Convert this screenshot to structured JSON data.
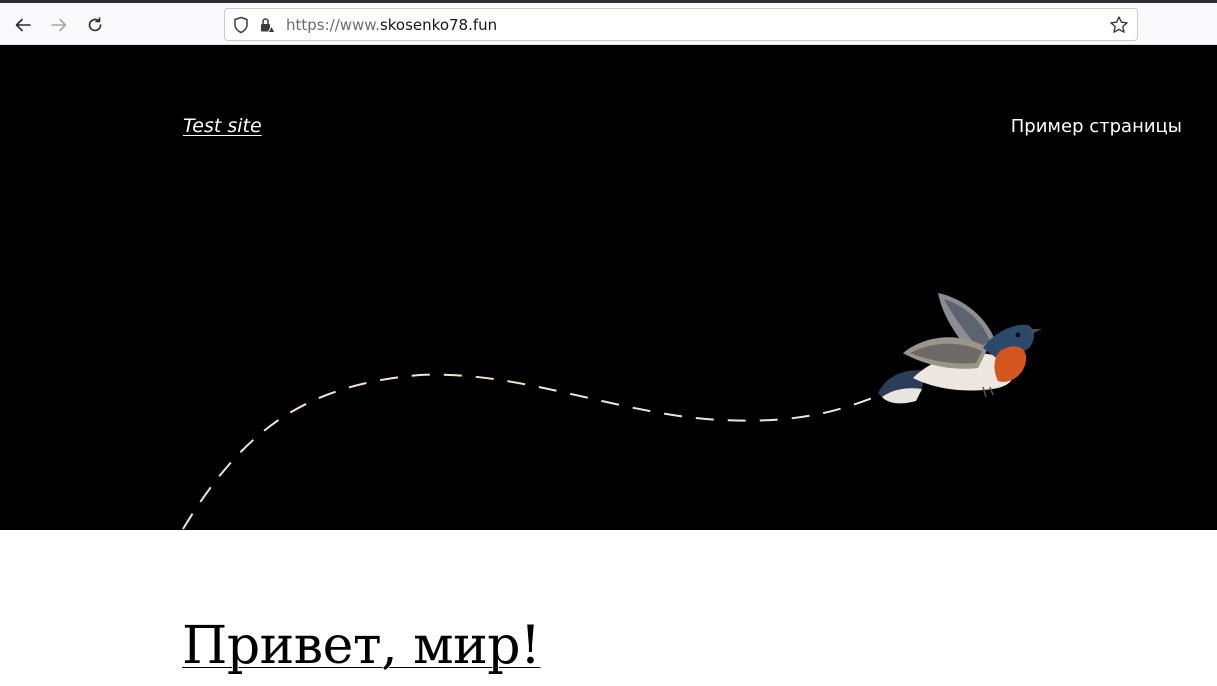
{
  "browser": {
    "url_prefix": "https://www.",
    "url_domain": "skosenko78.fun",
    "icons": {
      "back": "arrow-left-icon",
      "forward": "arrow-right-icon",
      "reload": "reload-icon",
      "shield": "shield-icon",
      "lock": "lock-warning-icon",
      "bookmark": "star-icon"
    }
  },
  "site": {
    "title": "Test site",
    "nav": [
      "Пример страницы"
    ]
  },
  "hero": {
    "image": "flying-bird-illustration",
    "background_color": "#000000",
    "path_color": "#f5e6c8"
  },
  "post": {
    "title": "Привет, мир!"
  }
}
